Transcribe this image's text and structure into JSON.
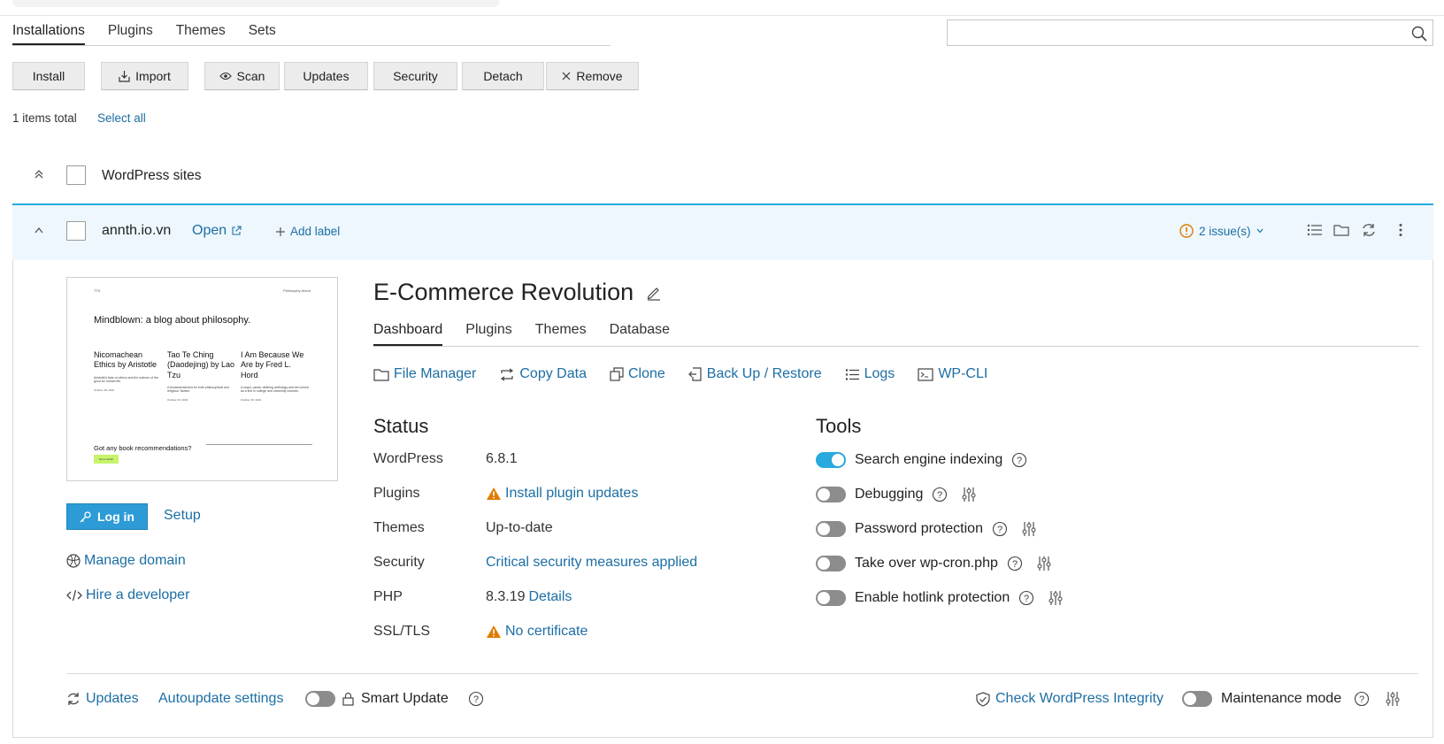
{
  "main_tabs": [
    "Installations",
    "Plugins",
    "Themes",
    "Sets"
  ],
  "toolbar": {
    "install": "Install",
    "import": "Import",
    "scan": "Scan",
    "updates": "Updates",
    "security": "Security",
    "detach": "Detach",
    "remove": "Remove"
  },
  "list": {
    "count_text": "1 items total",
    "select_all": "Select all",
    "group_label": "WordPress sites"
  },
  "site": {
    "domain": "annth.io.vn",
    "open": "Open",
    "add_label": "Add label",
    "issues": "2 issue(s)",
    "title": "E-Commerce Revolution",
    "tabs": [
      "Dashboard",
      "Plugins",
      "Themes",
      "Database"
    ],
    "actions": {
      "file_manager": "File Manager",
      "copy_data": "Copy Data",
      "clone": "Clone",
      "backup": "Back Up / Restore",
      "logs": "Logs",
      "wpcli": "WP-CLI"
    },
    "login": "Log in",
    "setup": "Setup",
    "manage_domain": "Manage domain",
    "hire_developer": "Hire a developer",
    "preview": {
      "site_title": "TT5",
      "nav": "Philosophy  About",
      "headline": "Mindblown: a blog about philosophy.",
      "posts": [
        {
          "title": "Nicomachean Ethics by Aristotle",
          "excerpt": "Aristotle's take on ethics and the science of the good for human life.",
          "date": "October 18, 2022"
        },
        {
          "title": "Tao Te Ching (Daodejing) by Lao Tzu",
          "excerpt": "A fundamental text for both philosophical and religious Taoism.",
          "date": "October 16, 2022"
        },
        {
          "title": "I Am Because We Are by Fred L. Hord",
          "excerpt": "A major, career-defining anthology and set coined as a text in college and university courses.",
          "date": "October 15, 2022"
        }
      ],
      "reco": "Got any book recommendations?",
      "button": "Get in touch"
    }
  },
  "status": {
    "heading": "Status",
    "rows": [
      {
        "label": "WordPress",
        "value": "6.8.1"
      },
      {
        "label": "Plugins",
        "value": "Install plugin updates"
      },
      {
        "label": "Themes",
        "value": "Up-to-date"
      },
      {
        "label": "Security",
        "value": "Critical security measures applied"
      },
      {
        "label": "PHP",
        "value": "8.3.19",
        "extra": "Details"
      },
      {
        "label": "SSL/TLS",
        "value": "No certificate"
      }
    ]
  },
  "tools": {
    "heading": "Tools",
    "items": [
      {
        "label": "Search engine indexing",
        "on": true
      },
      {
        "label": "Debugging",
        "on": false
      },
      {
        "label": "Password protection",
        "on": false
      },
      {
        "label": "Take over wp-cron.php",
        "on": false
      },
      {
        "label": "Enable hotlink protection",
        "on": false
      }
    ]
  },
  "footer": {
    "updates": "Updates",
    "autoupdate": "Autoupdate settings",
    "smart_update": "Smart Update",
    "check_integrity": "Check WordPress Integrity",
    "maintenance": "Maintenance mode"
  },
  "colors": {
    "link": "#1c6ea4",
    "accent": "#28aade",
    "warning": "#e07b00",
    "header_bg": "#eef7fd"
  }
}
